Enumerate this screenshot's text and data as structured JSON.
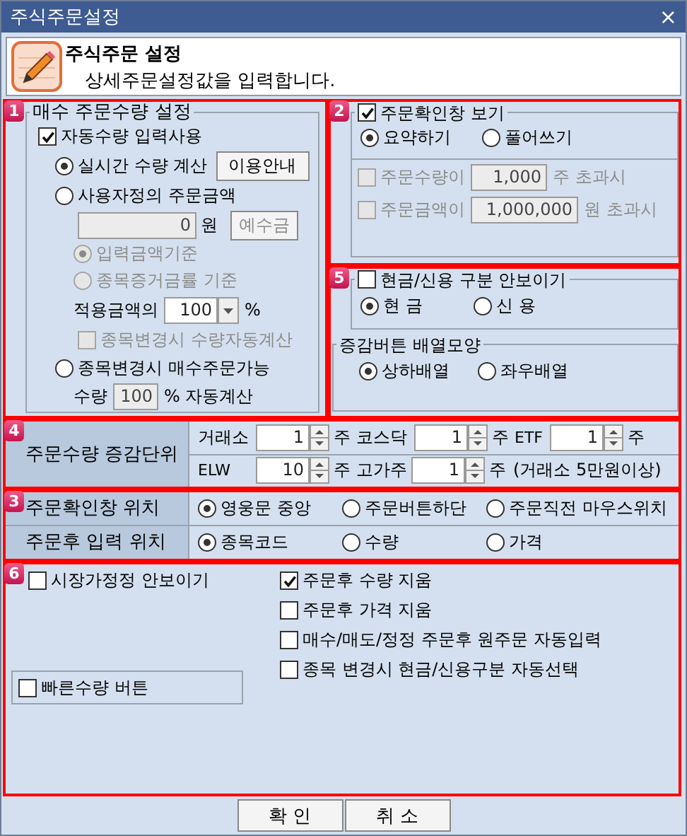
{
  "window": {
    "title": "주식주문설정",
    "close": "×"
  },
  "header": {
    "title": "주식주문 설정",
    "subtitle": "상세주문설정값을 입력합니다."
  },
  "order_qty": {
    "badge": "1",
    "title": "매수 주문수량 설정",
    "auto": {
      "label": "자동수량 입력사용",
      "checked": true
    },
    "realtime": {
      "label": "실시간 수량 계산",
      "selected": true,
      "button": "이용안내"
    },
    "custom": {
      "label": "사용자정의 주문금액",
      "selected": false,
      "amount": "0",
      "unit": "원",
      "button": "예수금",
      "inputs_disabled": true
    },
    "basis": [
      {
        "label": "입력금액기준",
        "selected": true,
        "disabled": true
      },
      {
        "label": "종목증거금률 기준",
        "selected": false,
        "disabled": true
      }
    ],
    "apply": {
      "label": "적용금액의",
      "value": "100",
      "unit": "%"
    },
    "recalc": {
      "label": "종목변경시 수량자동계산",
      "checked": false,
      "disabled": true
    },
    "on_change": {
      "label": "종목변경시 매수주문가능",
      "selected": false,
      "prefix": "수량",
      "value": "100",
      "value_disabled": true,
      "suffix": "% 자동계산"
    }
  },
  "confirm_window": {
    "badge": "2",
    "toggle": {
      "label": "주문확인창 보기",
      "checked": true
    },
    "modes": [
      {
        "label": "요약하기",
        "selected": true
      },
      {
        "label": "풀어쓰기",
        "selected": false
      }
    ],
    "thresholds": [
      {
        "label": "주문수량이",
        "value": "1,000",
        "suffix": "주 초과시",
        "checked": false,
        "disabled": true
      },
      {
        "label": "주문금액이",
        "value": "1,000,000",
        "suffix": "원 초과시",
        "checked": false,
        "disabled": true
      }
    ]
  },
  "cash_credit": {
    "badge": "5",
    "toggle": {
      "label": "현금/신용 구분 안보이기",
      "checked": false
    },
    "options": [
      {
        "label": "현 금",
        "selected": true
      },
      {
        "label": "신 용",
        "selected": false
      }
    ],
    "arrangement": {
      "title": "증감버튼 배열모양",
      "options": [
        {
          "label": "상하배열",
          "selected": true
        },
        {
          "label": "좌우배열",
          "selected": false
        }
      ]
    }
  },
  "step_units": {
    "badge": "4",
    "label": "주문수량 증감단위",
    "rows": [
      {
        "items": [
          {
            "label": "거래소",
            "value": "1",
            "unit": "주"
          },
          {
            "label": "코스닥",
            "value": "1",
            "unit": "주"
          },
          {
            "label": "ETF",
            "value": "1",
            "unit": "주"
          }
        ]
      },
      {
        "items": [
          {
            "label": "ELW",
            "value": "10",
            "unit": "주"
          },
          {
            "label": "고가주",
            "value": "1",
            "unit": "주",
            "note": "(거래소 5만원이상)"
          }
        ]
      }
    ]
  },
  "positions": {
    "badge": "3",
    "rows": [
      {
        "label": "주문확인창 위치",
        "options": [
          {
            "label": "영웅문 중앙",
            "selected": true
          },
          {
            "label": "주문버튼하단",
            "selected": false
          },
          {
            "label": "주문직전 마우스위치",
            "selected": false
          }
        ]
      },
      {
        "label": "주문후 입력 위치",
        "options": [
          {
            "label": "종목코드",
            "selected": true
          },
          {
            "label": "수량",
            "selected": false
          },
          {
            "label": "가격",
            "selected": false
          }
        ]
      }
    ]
  },
  "misc": {
    "badge": "6",
    "left": [
      {
        "label": "시장가정정 안보이기",
        "checked": false
      }
    ],
    "right": [
      {
        "label": "주문후 수량 지움",
        "checked": true
      },
      {
        "label": "주문후 가격 지움",
        "checked": false
      },
      {
        "label": "매수/매도/정정 주문후 원주문 자동입력",
        "checked": false
      },
      {
        "label": "종목 변경시 현금/신용구분 자동선택",
        "checked": false
      }
    ],
    "quick": {
      "label": "빠른수량 버튼",
      "checked": false
    }
  },
  "buttons": [
    "확 인",
    "취 소"
  ]
}
